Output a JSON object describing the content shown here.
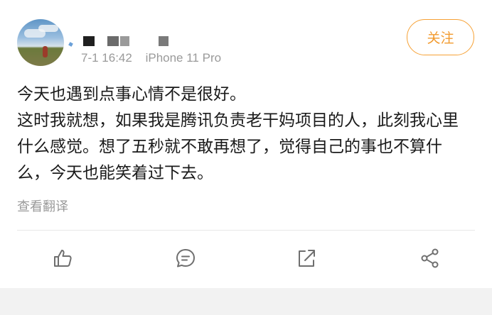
{
  "post": {
    "meta": {
      "time": "7-1 16:42",
      "device": "iPhone 11 Pro"
    },
    "follow_label": "关注",
    "lines": [
      "今天也遇到点事心情不是很好。",
      "这时我就想，如果我是腾讯负责老干妈项目的人，此刻我心里什么感觉。想了五秒就不敢再想了，觉得自己的事也不算什么，今天也能笑着过下去。"
    ],
    "translate_label": "查看翻译"
  },
  "actions": {
    "icons": [
      "thumb-up-icon",
      "comment-icon",
      "repost-icon",
      "share-icon"
    ]
  },
  "colors": {
    "accent": "#f29a2e",
    "meta_text": "#9a9a9a",
    "icon": "#6f6f6f",
    "background": "#f2f2f2"
  }
}
